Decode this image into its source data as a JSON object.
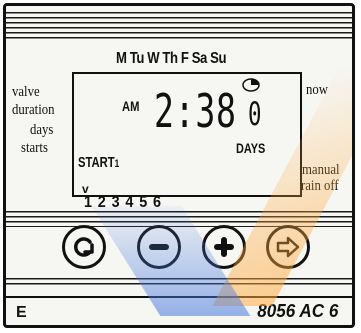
{
  "panel": {
    "weekdays": "M Tu W Th F Sa Su",
    "left_labels": [
      "valve",
      "duration",
      "days",
      "starts"
    ],
    "right_top_label": "now",
    "right_bottom_labels": [
      "manual",
      "rain off"
    ],
    "station_numbers": "1 2 3 4 5 6",
    "model_letter": "E",
    "model_name": "8056 AC 6"
  },
  "display": {
    "meridiem": "AM",
    "time": "2:38",
    "day_count": "0",
    "days_label": "DAYS",
    "start_label": "START",
    "start_number": "1",
    "pointer": "v"
  },
  "buttons": [
    {
      "name": "cycle-button",
      "icon": "cycle-arrow-icon"
    },
    {
      "name": "minus-button",
      "icon": "minus-icon"
    },
    {
      "name": "plus-button",
      "icon": "plus-icon"
    },
    {
      "name": "next-button",
      "icon": "right-arrow-icon"
    }
  ],
  "colors": {
    "ink": "#111111",
    "panel": "#f6f6f3",
    "watermark_orange": "#ffaa3c",
    "watermark_blue": "#4678dc"
  }
}
